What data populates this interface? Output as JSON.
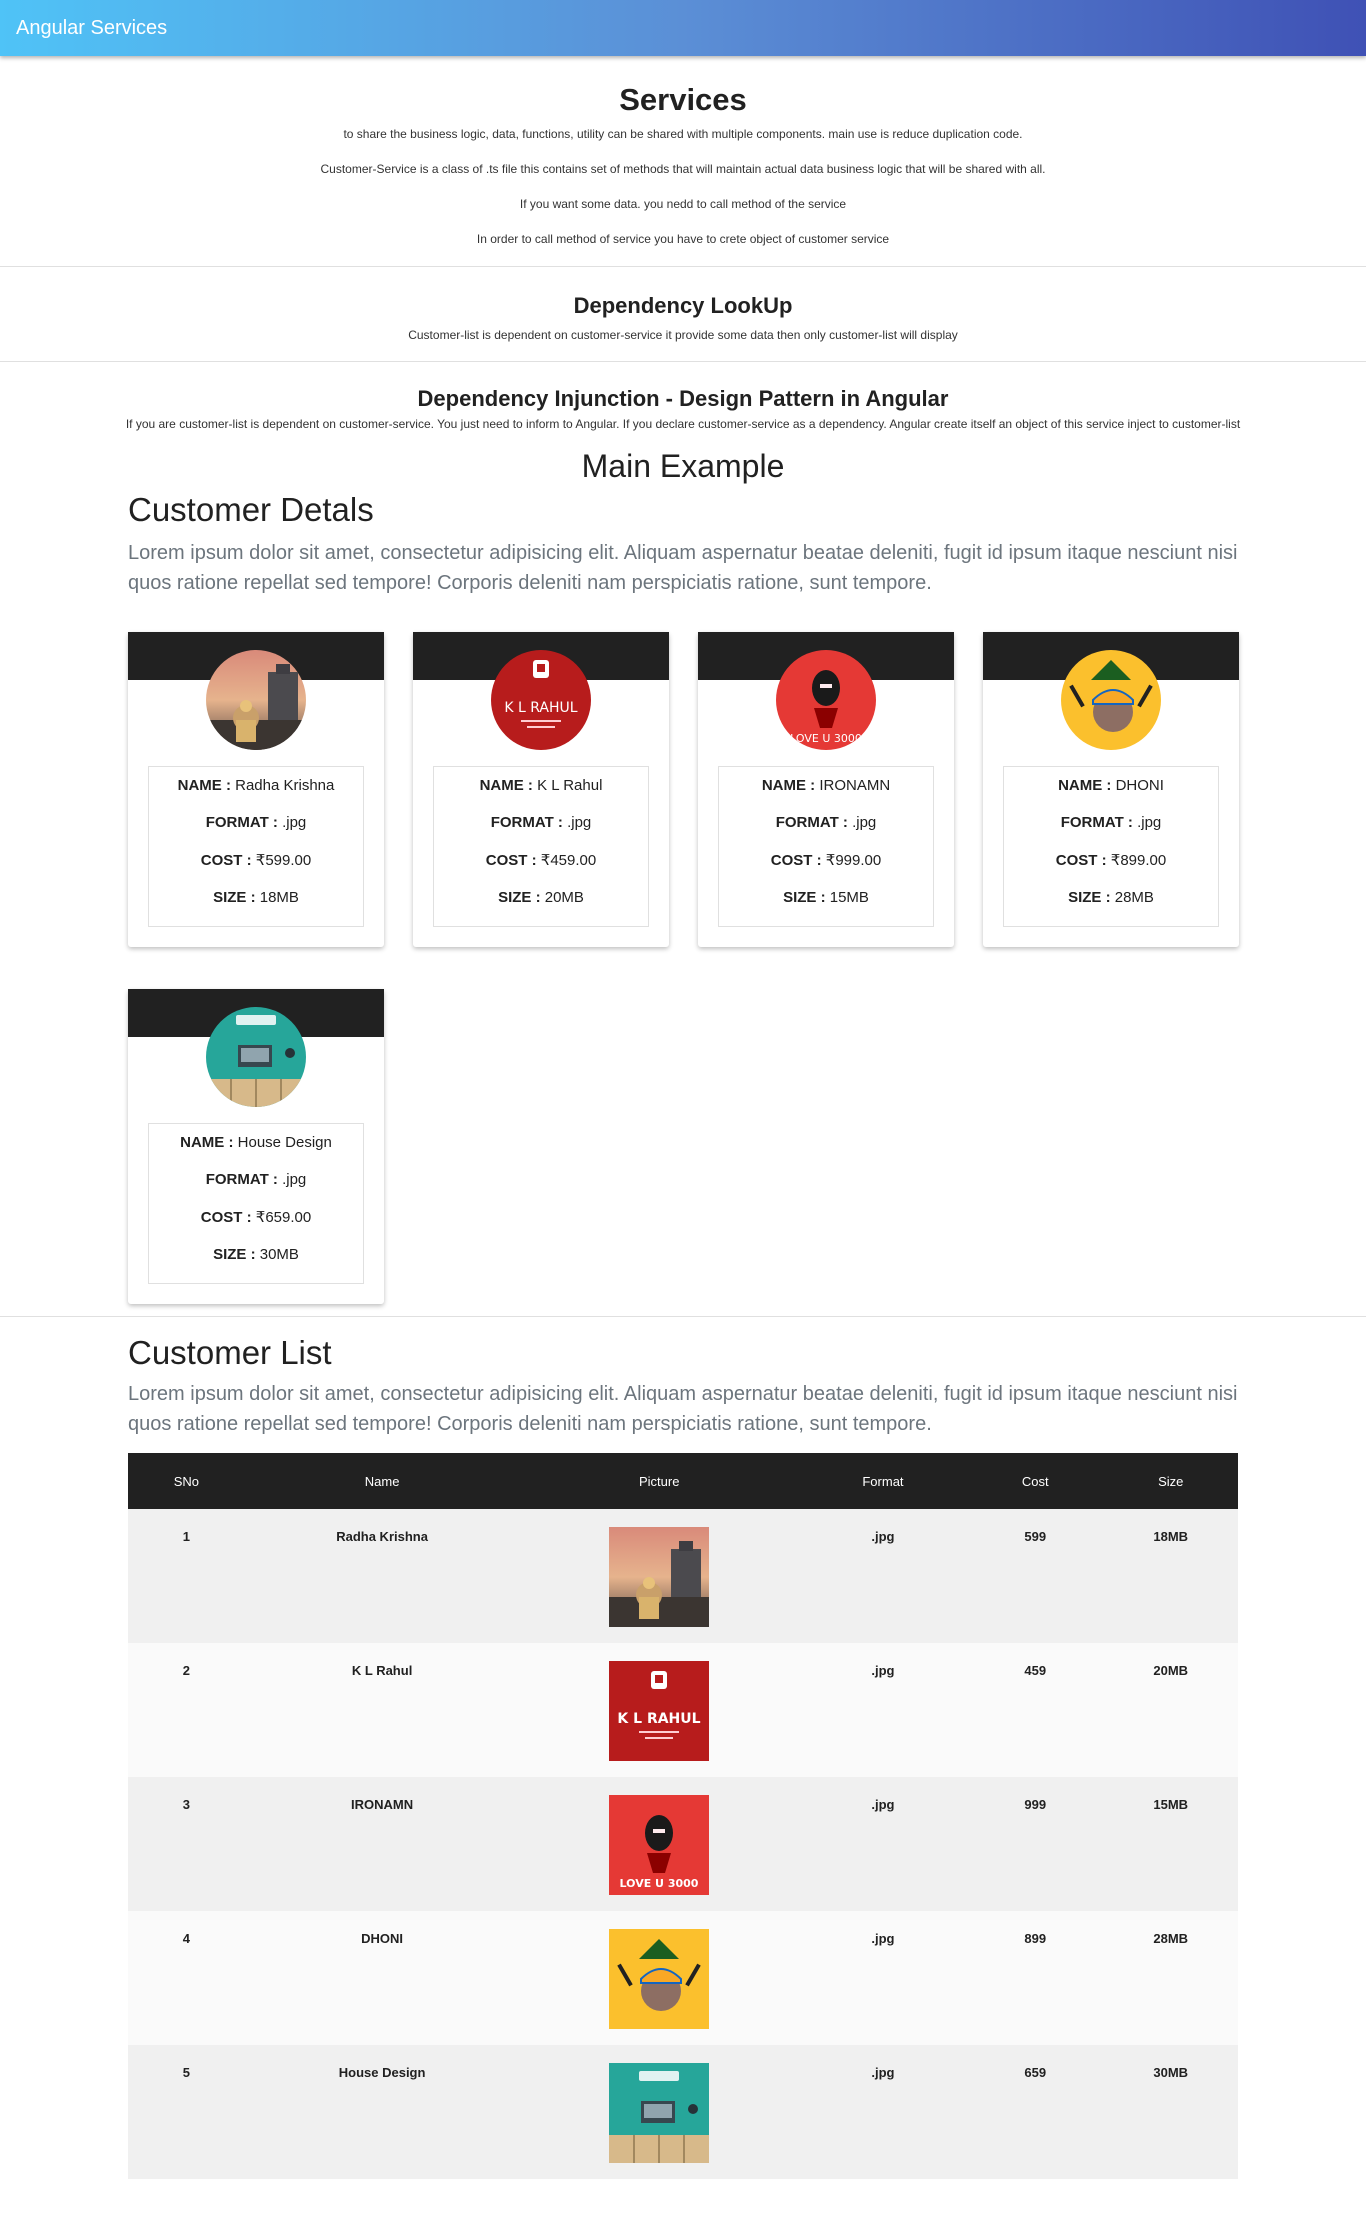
{
  "header": {
    "title": "Angular Services"
  },
  "services": {
    "title": "Services",
    "lines": [
      "to share the business logic, data, functions, utility can be shared with multiple components. main use is reduce duplication code.",
      "Customer-Service is a class of .ts file this contains set of methods that will maintain actual data business logic that will be shared with all.",
      "If you want some data. you nedd to call method of the service",
      "In order to call method of service you have to crete object of customer service"
    ]
  },
  "lookup": {
    "title": "Dependency LookUp",
    "text": "Customer-list is dependent on customer-service it provide some data then only customer-list will display"
  },
  "injection": {
    "title": "Dependency Injunction - Design Pattern in Angular",
    "text": "If you are customer-list is dependent on customer-service. You just need to inform to Angular. If you declare customer-service as a dependency. Angular create itself an object of this service inject to customer-list"
  },
  "main_example": {
    "title": "Main Example"
  },
  "details": {
    "title": "Customer Detals",
    "text": "Lorem ipsum dolor sit amet, consectetur adipisicing elit. Aliquam aspernatur beatae deleniti, fugit id ipsum itaque nesciunt nisi quos ratione repellat sed tempore! Corporis deleniti nam perspiciatis ratione, sunt tempore.",
    "labels": {
      "name": "NAME :",
      "format": "FORMAT :",
      "cost": "COST :",
      "size": "SIZE :"
    },
    "cards": [
      {
        "name": "Radha Krishna",
        "format": ".jpg",
        "cost": "₹599.00",
        "size": "18MB",
        "image": "temple-icon"
      },
      {
        "name": "K L Rahul",
        "format": ".jpg",
        "cost": "₹459.00",
        "size": "20MB",
        "image": "kl-rahul-icon",
        "image_text": "K L RAHUL"
      },
      {
        "name": "IRONAMN",
        "format": ".jpg",
        "cost": "₹999.00",
        "size": "15MB",
        "image": "ironman-icon",
        "image_text": "LOVE U 3000"
      },
      {
        "name": "DHONI",
        "format": ".jpg",
        "cost": "₹899.00",
        "size": "28MB",
        "image": "dhoni-icon"
      },
      {
        "name": "House Design",
        "format": ".jpg",
        "cost": "₹659.00",
        "size": "30MB",
        "image": "house-icon"
      }
    ]
  },
  "list": {
    "title": "Customer List",
    "text": "Lorem ipsum dolor sit amet, consectetur adipisicing elit. Aliquam aspernatur beatae deleniti, fugit id ipsum itaque nesciunt nisi quos ratione repellat sed tempore! Corporis deleniti nam perspiciatis ratione, sunt tempore.",
    "columns": [
      "SNo",
      "Name",
      "Picture",
      "Format",
      "Cost",
      "Size"
    ],
    "rows": [
      {
        "sno": "1",
        "name": "Radha Krishna",
        "format": ".jpg",
        "cost": "599",
        "size": "18MB"
      },
      {
        "sno": "2",
        "name": "K L Rahul",
        "format": ".jpg",
        "cost": "459",
        "size": "20MB"
      },
      {
        "sno": "3",
        "name": "IRONAMN",
        "format": ".jpg",
        "cost": "999",
        "size": "15MB"
      },
      {
        "sno": "4",
        "name": "DHONI",
        "format": ".jpg",
        "cost": "899",
        "size": "28MB"
      },
      {
        "sno": "5",
        "name": "House Design",
        "format": ".jpg",
        "cost": "659",
        "size": "30MB"
      }
    ]
  },
  "colors": {
    "header_start": "#4fc3f7",
    "header_end": "#3f51b5",
    "dark": "#212121",
    "kl_red": "#b71c1c",
    "iron_red": "#e53935",
    "dhoni_yellow": "#fbc02d",
    "house_teal": "#26a69a"
  }
}
